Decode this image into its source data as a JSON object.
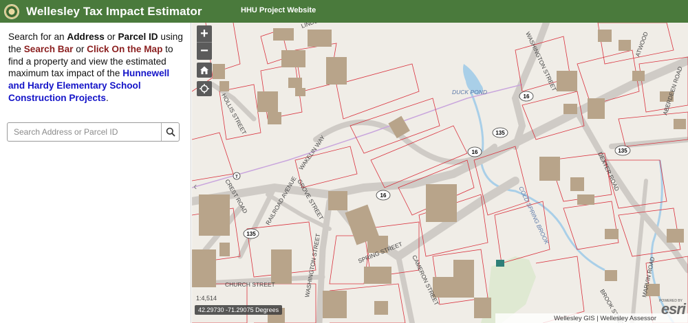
{
  "header": {
    "title": "Wellesley Tax Impact Estimator",
    "project_link": "HHU Project Website",
    "color": "#4a7a3c"
  },
  "sidebar": {
    "intro": {
      "p1": "Search for an ",
      "address": "Address",
      "p2": " or ",
      "parcel": "Parcel ID",
      "p3": " using the ",
      "search_bar": "Search Bar",
      "p4": " or ",
      "click_map": "Click On the Map",
      "p5": " to find a property and view the estimated maximum tax impact of the ",
      "projects": "Hunnewell and Hardy Elementary School Construction Projects",
      "p6": "."
    },
    "search": {
      "placeholder": "Search Address or Parcel ID",
      "value": ""
    }
  },
  "map": {
    "zoom_in": "+",
    "zoom_out": "−",
    "scale": "1:4,514",
    "coordinates": "42.29730 -71.29075 Degrees",
    "attribution": "Wellesley GIS | Wellesley Assessor",
    "esri_logo": "esri",
    "esri_powered": "POWERED BY",
    "labels": {
      "hollis": "HOLLIS STREET",
      "linden": "LINDEN",
      "washington_n": "WASHINGTON STREET",
      "atwood": "ATWOOD",
      "aberdeen": "ABERDEEN ROAD",
      "duck_pond": "DUCK POND",
      "wakelin": "WAKELIN WAY",
      "crest": "CREST ROAD",
      "railroad": "RAILROAD AVENUE",
      "grove": "GROVE STREET",
      "dexter": "DEXTER ROAD",
      "cold_spring": "COLD SPRING BROOK",
      "spring": "SPRING STREET",
      "cameron": "CAMERON STREET",
      "washington_s": "WASHINGTON STREET",
      "church": "CHURCH STREET",
      "marvin": "MARVIN ROAD",
      "brook": "BROOK STREET",
      "r16a": "16",
      "r16b": "16",
      "r16c": "16",
      "r135a": "135",
      "r135b": "135",
      "r135c": "135",
      "transit": "T"
    },
    "colors": {
      "background": "#f0ede7",
      "building": "#b8a48a",
      "parcel": "#d9303c",
      "road": "#cfcbc6",
      "water": "#a9cfe8",
      "park": "#dfe9d2"
    }
  }
}
